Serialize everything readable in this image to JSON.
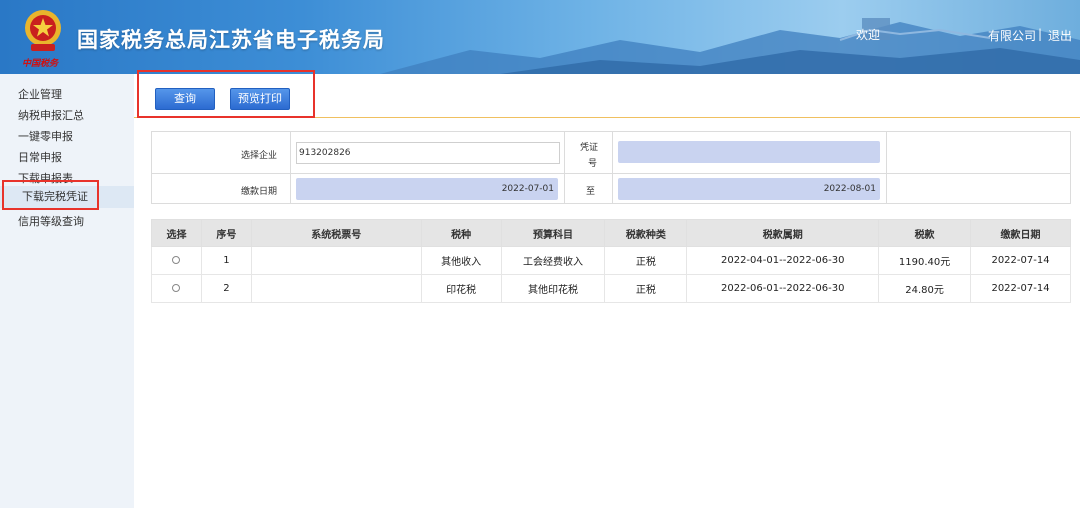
{
  "header": {
    "logo_text": "中国税务",
    "title": "国家税务总局江苏省电子税务局",
    "welcome": "欢迎",
    "company": "有限公司",
    "separator": "|",
    "logout": "退出"
  },
  "sidebar": {
    "items": [
      {
        "label": "企业管理"
      },
      {
        "label": "纳税申报汇总"
      },
      {
        "label": "一键零申报"
      },
      {
        "label": "日常申报"
      },
      {
        "label": "下载申报表"
      },
      {
        "label": "下载完税凭证"
      },
      {
        "label": "信用等级查询"
      }
    ],
    "active_index": 5
  },
  "toolbar": {
    "query_label": "查询",
    "print_preview_label": "预览打印"
  },
  "form": {
    "company_label": "选择企业",
    "company_value": "913202826",
    "voucher_label_1": "凭证",
    "voucher_label_2": "号",
    "voucher_value": "",
    "pay_date_label": "缴款日期",
    "date_from": "2022-07-01",
    "to_label": "至",
    "date_to": "2022-08-01"
  },
  "table": {
    "headers": [
      "选择",
      "序号",
      "系统税票号",
      "税种",
      "预算科目",
      "税款种类",
      "税款属期",
      "税款",
      "缴款日期"
    ],
    "rows": [
      {
        "seq": "1",
        "ticket": "",
        "tax_type": "其他收入",
        "budget": "工会经费收入",
        "kind": "正税",
        "period": "2022-04-01--2022-06-30",
        "amount": "1190.40元",
        "pay_date": "2022-07-14"
      },
      {
        "seq": "2",
        "ticket": "",
        "tax_type": "印花税",
        "budget": "其他印花税",
        "kind": "正税",
        "period": "2022-06-01--2022-06-30",
        "amount": "24.80元",
        "pay_date": "2022-07-14"
      }
    ]
  },
  "colors": {
    "highlight_border": "#e8332b",
    "button_blue": "#2c6bd1",
    "input_blue": "#c9d3f0",
    "sidebar_bg": "#eef3f9"
  }
}
